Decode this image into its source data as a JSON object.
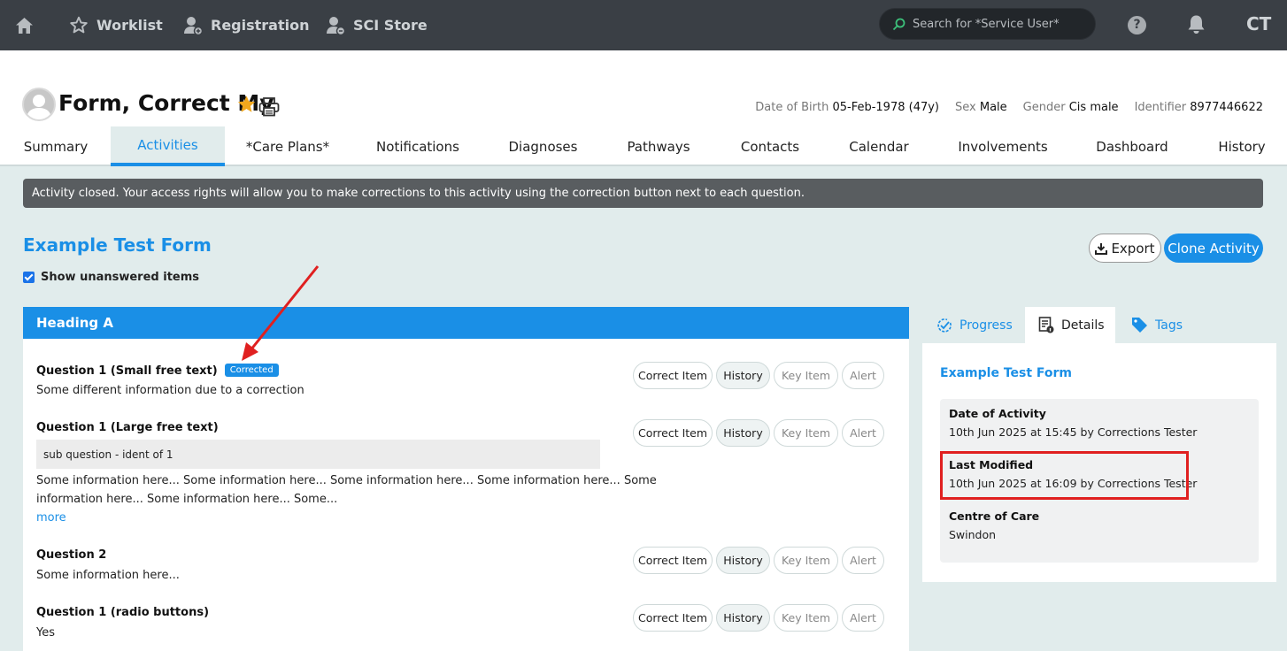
{
  "topnav": {
    "worklist": "Worklist",
    "registration": "Registration",
    "sci_store": "SCI Store",
    "search_placeholder": "Search for *Service User*",
    "help": "?",
    "user_initials": "CT"
  },
  "patient": {
    "name": "Form, Correct My",
    "dob_label": "Date of Birth",
    "dob_value": "05-Feb-1978 (47y)",
    "sex_label": "Sex",
    "sex_value": "Male",
    "gender_label": "Gender",
    "gender_value": "Cis male",
    "identifier_label": "Identifier",
    "identifier_value": "8977446622"
  },
  "tabs": [
    "Summary",
    "Activities",
    "*Care Plans*",
    "Notifications",
    "Diagnoses",
    "Pathways",
    "Contacts",
    "Calendar",
    "Involvements",
    "Dashboard",
    "History"
  ],
  "notice": "Activity closed. Your access rights will allow you to make corrections to this activity using the correction button next to each question.",
  "form": {
    "title": "Example Test Form",
    "show_unanswered": "Show unanswered items",
    "export": "Export",
    "clone": "Clone Activity",
    "heading": "Heading A",
    "corrected_badge": "Corrected",
    "questions": [
      {
        "label": "Question 1 (Small free text)",
        "answer": "Some different information due to a correction"
      },
      {
        "label": "Question 1 (Large free text)",
        "sub": "sub question - ident of 1",
        "answer_line1": "Some information here... Some information here... Some information here... Some information here... Some",
        "answer_line2": "information here... Some information here... Some...",
        "more": "more"
      },
      {
        "label": "Question 2",
        "answer": "Some information here..."
      },
      {
        "label": "Question 1 (radio buttons)",
        "answer": "Yes"
      }
    ],
    "buttons": {
      "correct": "Correct Item",
      "history": "History",
      "key": "Key Item",
      "alert": "Alert"
    }
  },
  "side": {
    "tabs": {
      "progress": "Progress",
      "details": "Details",
      "tags": "Tags"
    },
    "title": "Example Test Form",
    "date_of_activity_label": "Date of Activity",
    "date_of_activity_value": "10th Jun 2025 at 15:45 by Corrections Tester",
    "last_modified_label": "Last Modified",
    "last_modified_value": "10th Jun 2025 at 16:09 by Corrections Tester",
    "centre_label": "Centre of Care",
    "centre_value": "Swindon"
  },
  "colors": {
    "accent": "#1a8fe6",
    "topbar": "#3a3f45",
    "highlight": "#e02020"
  }
}
